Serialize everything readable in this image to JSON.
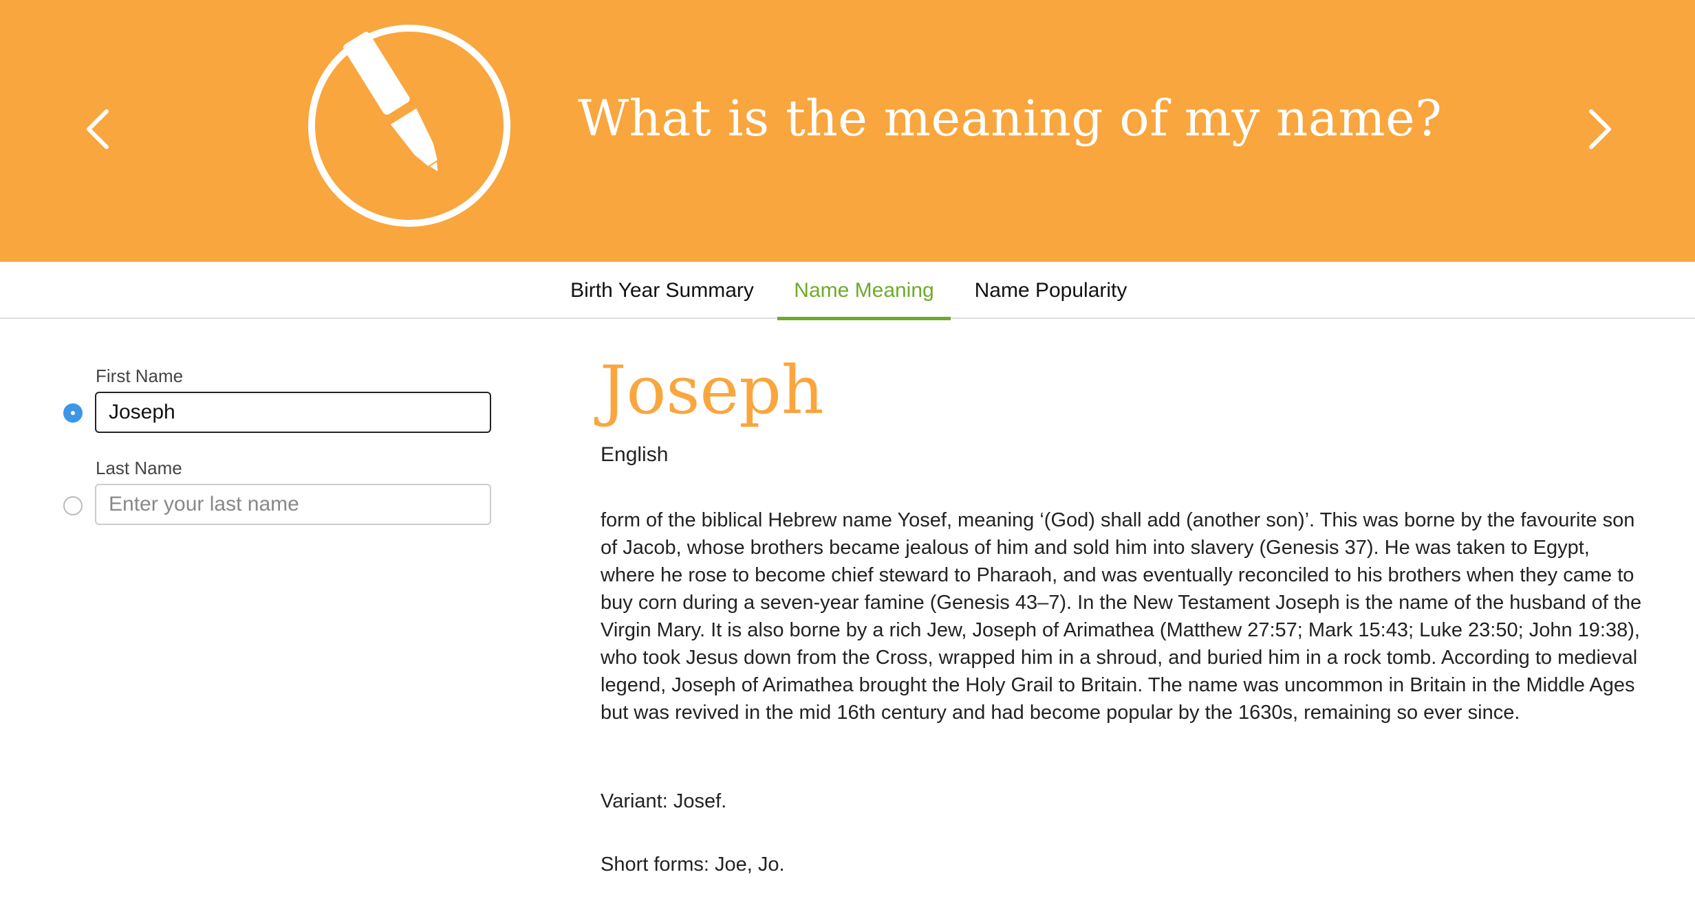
{
  "header": {
    "title": "What is the meaning of my name?",
    "background_color": "#f9a63e",
    "logo_icon": "pen-in-circle-icon",
    "prev_icon": "chevron-left-icon",
    "next_icon": "chevron-right-icon"
  },
  "tabs": [
    {
      "label": "Birth Year Summary",
      "active": false
    },
    {
      "label": "Name Meaning",
      "active": true
    },
    {
      "label": "Name Popularity",
      "active": false
    }
  ],
  "accent_color": "#6eaa2a",
  "form": {
    "first_name_label": "First Name",
    "first_name_value": "Joseph",
    "first_name_selected": true,
    "last_name_label": "Last Name",
    "last_name_value": "",
    "last_name_placeholder": "Enter your last name",
    "last_name_selected": false
  },
  "result": {
    "name": "Joseph",
    "origin": "English",
    "description": "form of the biblical Hebrew name Yosef, meaning ‘(God) shall add (another son)’. This was borne by the favourite son of Jacob, whose brothers became jealous of him and sold him into slavery (Genesis 37). He was taken to Egypt, where he rose to become chief steward to Pharaoh, and was eventually reconciled to his brothers when they came to buy corn during a seven-year famine (Genesis 43–7). In the New Testament Joseph is the name of the husband of the Virgin Mary. It is also borne by a rich Jew, Joseph of Arimathea (Matthew 27:57; Mark 15:43; Luke 23:50; John 19:38), who took Jesus down from the Cross, wrapped him in a shroud, and buried him in a rock tomb. According to medieval legend, Joseph of Arimathea brought the Holy Grail to Britain. The name was uncommon in Britain in the Middle Ages but was revived in the mid 16th century and had become popular by the 1630s, remaining so ever since.",
    "variant": "Variant: Josef.",
    "short_forms": "Short forms: Joe, Jo."
  }
}
